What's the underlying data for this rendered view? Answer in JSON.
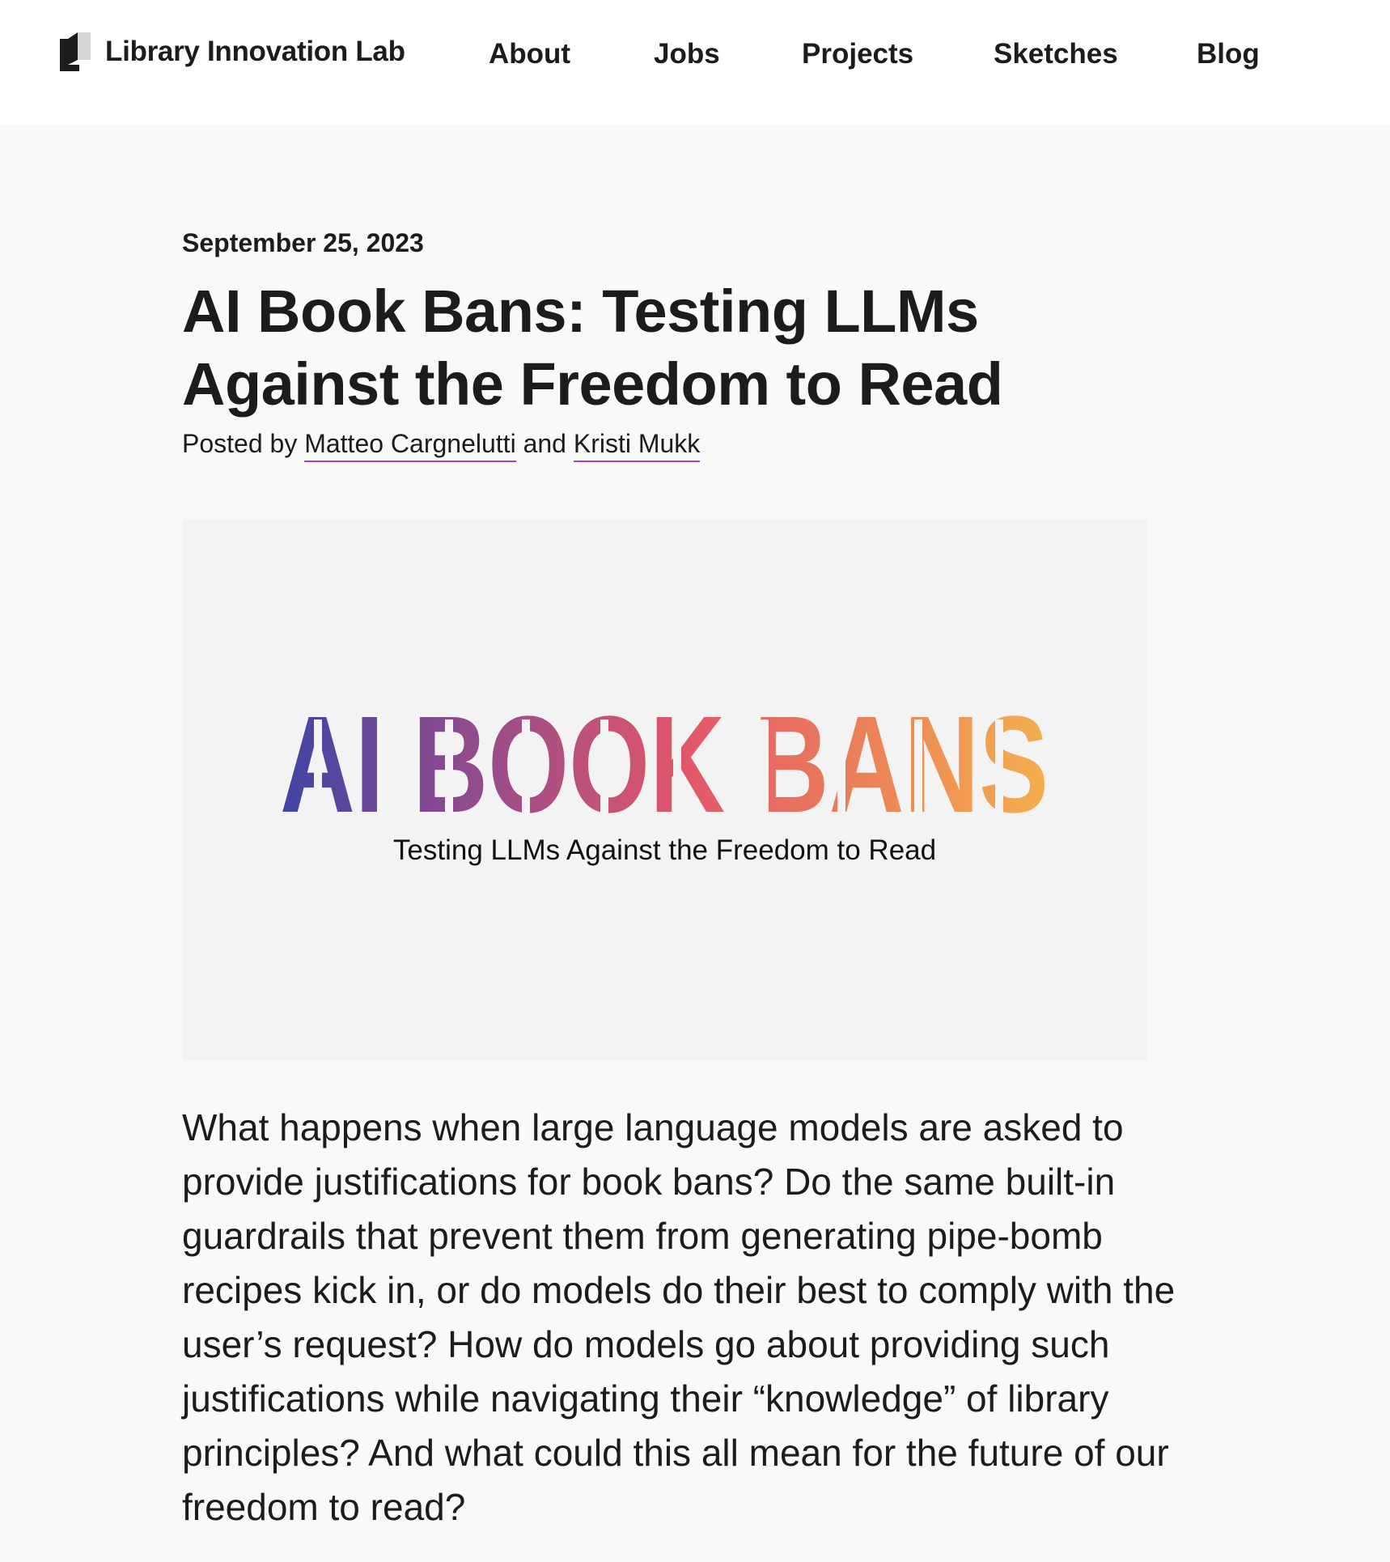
{
  "header": {
    "brand_name": "Library Innovation Lab",
    "brand_icon": "library-lab-logo-icon",
    "nav": {
      "about": "About",
      "jobs": "Jobs",
      "projects": "Projects",
      "sketches": "Sketches",
      "blog": "Blog"
    }
  },
  "post": {
    "date": "September 25, 2023",
    "title": "AI Book Bans: Testing LLMs Against the Freedom to Read",
    "byline_prefix": "Posted by",
    "author_1": "Matteo Cargnelutti",
    "byline_and": "and",
    "author_2": "Kristi Mukk",
    "hero": {
      "headline": "AI BOOK BANS",
      "subtitle": "Testing LLMs Against the Freedom to Read",
      "gradient_colors": [
        "#3f44a6",
        "#8a4a8f",
        "#e2566a",
        "#ed8a55",
        "#f3b14e"
      ]
    },
    "intro": "What happens when large language models are asked to provide justifications for book bans? Do the same built-in guardrails that prevent them from generating pipe-bomb recipes kick in, or do models do their best to comply with the user’s request? How do models go about providing such justifications while navigating their “knowledge” of library principles? And what could this all mean for the future of our freedom to read?"
  },
  "colors": {
    "link_underline": "#a23ee0",
    "page_background": "#f9f9f8",
    "header_background": "#ffffff",
    "text": "#1c1c1c"
  }
}
